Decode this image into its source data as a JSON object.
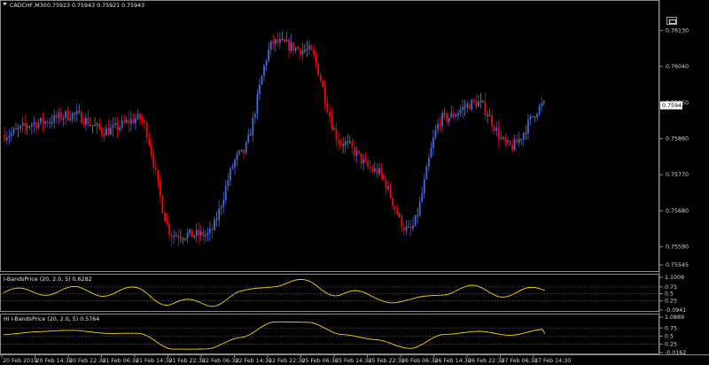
{
  "header": {
    "symbol_label": "CADCHF,M30",
    "ohlc_text": "0.75923 0.75943 0.75921 0.75943",
    "window_button_label": ""
  },
  "colors": {
    "background": "#000000",
    "bull_candle": "#4169e1",
    "bear_candle": "#ff0000",
    "neutral_candle": "#808080",
    "indicator_line": "#ffd700",
    "grid": "#3c3c3c",
    "current_price_box": "#ffffff"
  },
  "main_chart": {
    "price_labels": [
      "0.76130",
      "0.76040",
      "0.75950",
      "0.75860",
      "0.75770",
      "0.75680",
      "0.75590",
      "0.75545"
    ],
    "current_price": "0.75943",
    "current_price_value": 0.75943
  },
  "indicator_1": {
    "title": "I-BandsPrice (20, 2.0, 5) 0.6282",
    "scale_labels": [
      "1.1009",
      "0.75",
      "0.5",
      "0.25",
      "-0.0941"
    ],
    "current_value": 0.6282
  },
  "indicator_2": {
    "title": "HI I-BandsPrice (20, 2.0, 5) 0.5764",
    "scale_labels": [
      "1.0889",
      "0.75",
      "0.5",
      "0.25",
      "-0.0162"
    ],
    "current_value": 0.5764
  },
  "time_axis": {
    "labels": [
      "20 Feb 2019",
      "20 Feb 14:30",
      "20 Feb 22:30",
      "21 Feb 06:30",
      "21 Feb 14:30",
      "21 Feb 22:30",
      "22 Feb 06:30",
      "22 Feb 14:30",
      "22 Feb 22:30",
      "25 Feb 06:30",
      "25 Feb 14:30",
      "25 Feb 22:30",
      "26 Feb 06:30",
      "26 Feb 14:30",
      "26 Feb 22:30",
      "27 Feb 06:30",
      "27 Feb 14:30"
    ]
  },
  "chart_data": {
    "type": "candlestick",
    "symbol": "CADCHF",
    "timeframe": "M30",
    "ylim": [
      0.75545,
      0.76175
    ],
    "close_path": [
      {
        "t": "20 Feb 2019",
        "v": 0.7587
      },
      {
        "t": "20 Feb 14:30",
        "v": 0.759
      },
      {
        "t": "20 Feb 22:30",
        "v": 0.7592
      },
      {
        "t": "21 Feb 06:30",
        "v": 0.7588
      },
      {
        "t": "21 Feb 14:30",
        "v": 0.7591
      },
      {
        "t": "21 Feb 22:30",
        "v": 0.7562
      },
      {
        "t": "22 Feb 06:30",
        "v": 0.7562
      },
      {
        "t": "22 Feb 14:30",
        "v": 0.7582
      },
      {
        "t": "22 Feb 22:30",
        "v": 0.761
      },
      {
        "t": "25 Feb 06:30",
        "v": 0.7608
      },
      {
        "t": "25 Feb 14:30",
        "v": 0.7585
      },
      {
        "t": "25 Feb 22:30",
        "v": 0.7578
      },
      {
        "t": "26 Feb 06:30",
        "v": 0.7563
      },
      {
        "t": "26 Feb 14:30",
        "v": 0.7591
      },
      {
        "t": "26 Feb 22:30",
        "v": 0.7595
      },
      {
        "t": "27 Feb 06:30",
        "v": 0.7584
      },
      {
        "t": "27 Feb 14:30",
        "v": 0.75943
      }
    ]
  }
}
